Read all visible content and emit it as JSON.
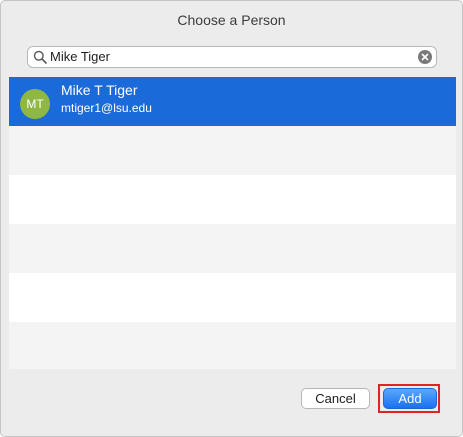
{
  "window": {
    "title": "Choose a Person"
  },
  "search": {
    "value": "Mike Tiger",
    "placeholder": ""
  },
  "results": [
    {
      "initials": "MT",
      "name": "Mike T Tiger",
      "email": "mtiger1@lsu.edu",
      "selected": true
    }
  ],
  "buttons": {
    "cancel_label": "Cancel",
    "add_label": "Add"
  },
  "colors": {
    "selection": "#1b6ad9",
    "avatar": "#8eb744",
    "default_button": "#1a6ff3",
    "annotation_box": "#e02424"
  },
  "icons": {
    "search": "magnifier-icon",
    "clear": "clear-circle-x-icon"
  }
}
